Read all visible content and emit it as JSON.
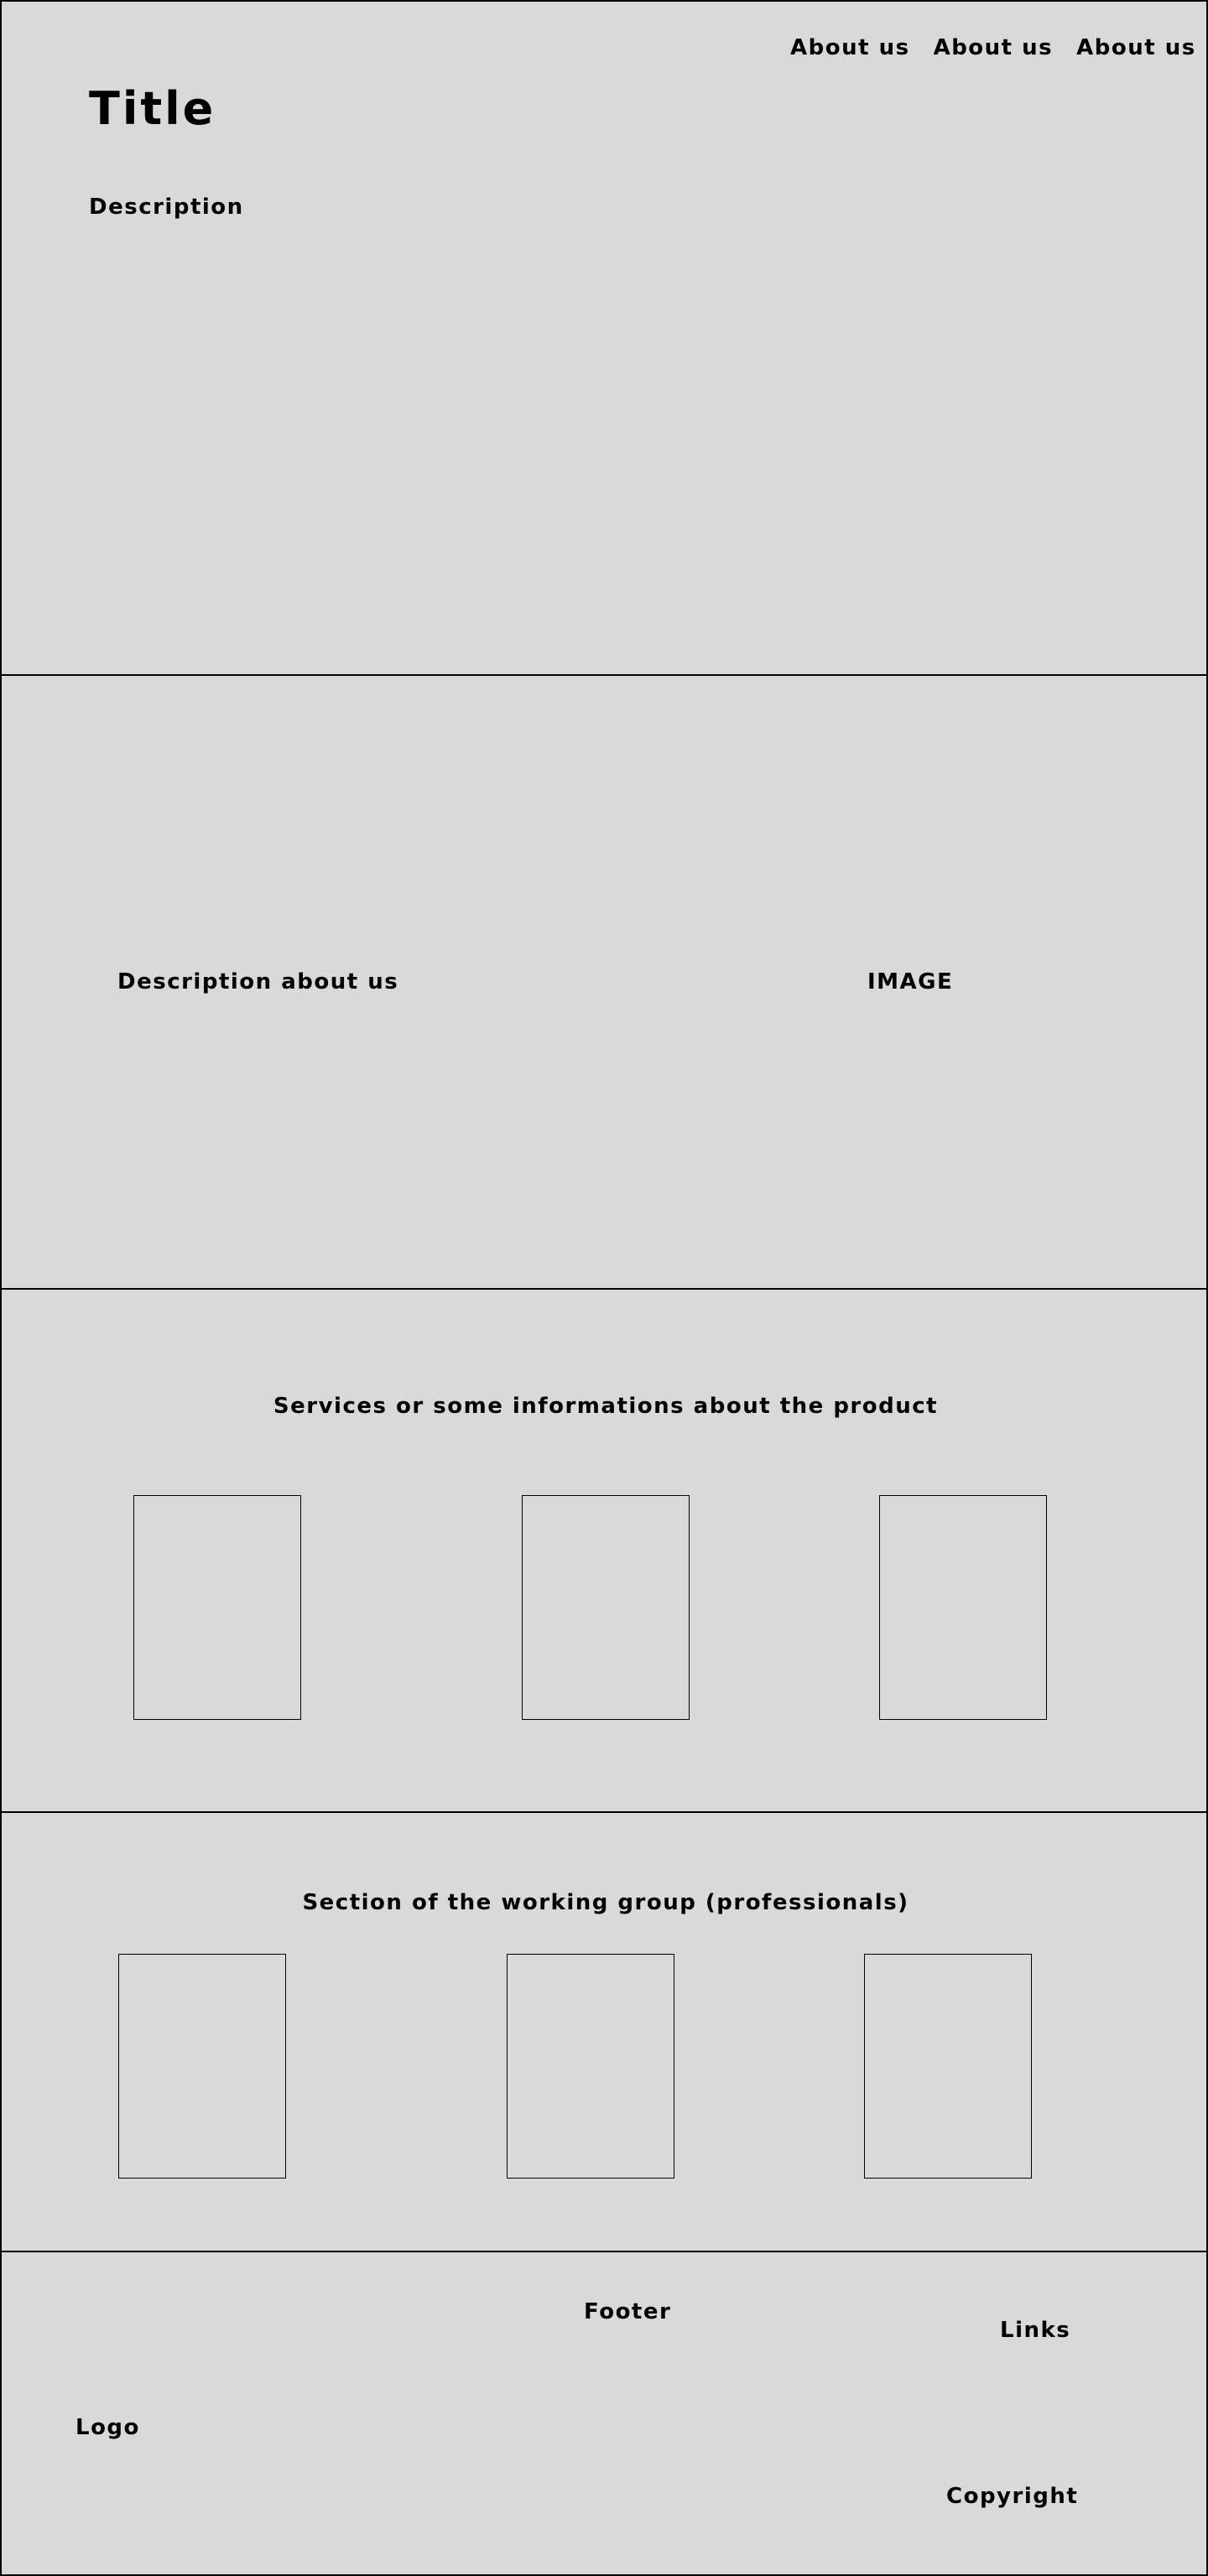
{
  "header": {
    "nav": [
      "About us",
      "About us",
      "About us"
    ],
    "title": "Title",
    "description": "Description"
  },
  "about": {
    "description": "Description about us",
    "image_label": "IMAGE"
  },
  "services": {
    "heading": "Services or some informations about the product"
  },
  "team": {
    "heading": "Section of the working group (professionals)"
  },
  "footer": {
    "heading": "Footer",
    "links": "Links",
    "logo": "Logo",
    "copyright": "Copyright"
  }
}
